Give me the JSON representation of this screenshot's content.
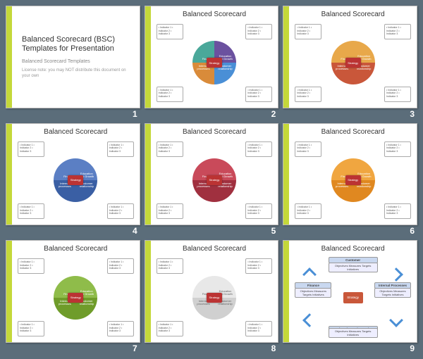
{
  "slides": [
    {
      "num": "1",
      "title_main": "Balanced Scorecard (BSC) Templates for Presentation",
      "title_sub": "Balanced Scorecard Templates",
      "title_note": "License note: you may NOT distribute this document on your own"
    },
    {
      "num": "2",
      "title": "Balanced Scorecard",
      "colors": {
        "tl": "#4aa89a",
        "tr": "#6b519f",
        "bl": "#d98b3a",
        "br": "#4a8fd6"
      },
      "labels": {
        "tl": "Finance",
        "tr": "Education and Growth",
        "bl": "Internal processes",
        "br": "Customer relationship",
        "center": "Strategy"
      },
      "ind": "• Indicator 1\n• Indicator 2\n• Indicator 3"
    },
    {
      "num": "3",
      "title": "Balanced Scorecard",
      "colors": {
        "tl": "#e8a84a",
        "tr": "#e8a84a",
        "bl": "#c9573a",
        "br": "#c9573a"
      },
      "labels": {
        "tl": "Finance",
        "tr": "Education and Growth",
        "bl": "Internal processes",
        "br": "Customer relationship",
        "center": "Strategy"
      },
      "ind": "• Indicator 1\n• Indicator 2\n• Indicator 3"
    },
    {
      "num": "4",
      "title": "Balanced Scorecard",
      "colors": {
        "tl": "#5b7fc4",
        "tr": "#5b7fc4",
        "bl": "#3a5fa4",
        "br": "#3a5fa4"
      },
      "labels": {
        "tl": "Finance",
        "tr": "Education and Growth",
        "bl": "Internal processes",
        "br": "Customer relationship",
        "center": "Strategy"
      },
      "ind": "• Indicator 1\n• Indicator 2\n• Indicator 3"
    },
    {
      "num": "5",
      "title": "Balanced Scorecard",
      "colors": {
        "tl": "#c94a5a",
        "tr": "#c94a5a",
        "bl": "#a0303f",
        "br": "#a0303f"
      },
      "labels": {
        "tl": "Finance",
        "tr": "Education and Growth",
        "bl": "Internal processes",
        "br": "Customer relationship",
        "center": "Strategy"
      },
      "ind": "• Indicator 1\n• Indicator 2\n• Indicator 3"
    },
    {
      "num": "6",
      "title": "Balanced Scorecard",
      "colors": {
        "tl": "#f0a640",
        "tr": "#f0a640",
        "bl": "#e08820",
        "br": "#e08820"
      },
      "labels": {
        "tl": "Finance",
        "tr": "Education and Growth",
        "bl": "Internal processes",
        "br": "Customer relationship",
        "center": "Strategy"
      },
      "ind": "• Indicator 1\n• Indicator 2\n• Indicator 3"
    },
    {
      "num": "7",
      "title": "Balanced Scorecard",
      "colors": {
        "tl": "#8fbc4a",
        "tr": "#8fbc4a",
        "bl": "#6f9c2a",
        "br": "#6f9c2a"
      },
      "labels": {
        "tl": "Finance",
        "tr": "Education and Growth",
        "bl": "Internal processes",
        "br": "Customer relationship",
        "center": "Strategy"
      },
      "ind": "• Indicator 1\n• Indicator 2\n• Indicator 3"
    },
    {
      "num": "8",
      "title": "Balanced Scorecard",
      "colors": {
        "tl": "#e8e8e8",
        "tr": "#e8e8e8",
        "bl": "#d0d0d0",
        "br": "#d0d0d0"
      },
      "labels": {
        "tl": "Finance",
        "tr": "Education and Growth",
        "bl": "Internal processes",
        "br": "Customer relationship",
        "center": "Strategy"
      },
      "text_color": "#666",
      "ind": "• Indicator 1\n• Indicator 2\n• Indicator 3"
    },
    {
      "num": "9",
      "title": "Balanced Scorecard",
      "flow": {
        "top": "Customer",
        "left": "Finance",
        "right": "Internal Processes",
        "bottom": "Education and Growth",
        "center": "Strategy",
        "cells": "Objectives  Measures  Targets  Initiatives"
      }
    }
  ]
}
